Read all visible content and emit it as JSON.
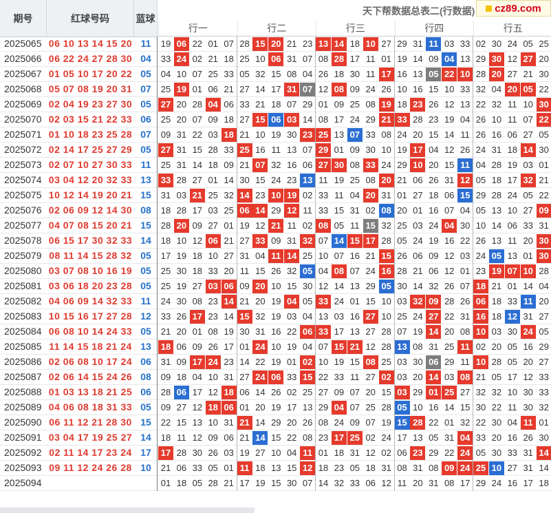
{
  "header": {
    "col_period": "期号",
    "col_red": "红球号码",
    "col_blue": "蓝球",
    "title": "天下帮数据总表二(行数据)",
    "logo": "cz89.com",
    "groups": [
      "行一",
      "行二",
      "行三",
      "行四",
      "行五"
    ]
  },
  "colors": {
    "red": "#e53a2c",
    "blue": "#2b6ed3",
    "gray": "#7d7d7d",
    "red_text": "#e03a2f",
    "blue_text": "#2570c8"
  },
  "rows": [
    {
      "period": "2025065",
      "reds": "06 10 13 14 15 20",
      "blue": "11",
      "cells": "19 *06 22 01 07|28 *15 *20 21 23|*13 *14 18 *10 27|29 31 +11 03 33|02 30 24 05 25"
    },
    {
      "period": "2025066",
      "reds": "06 22 24 27 28 30",
      "blue": "04",
      "cells": "33 *24 02 21 18|25 10 *06 31 07|08 *28 17 11 01|19 14 09 +04 13|29 *30 12 *27 20"
    },
    {
      "period": "2025067",
      "reds": "01 05 10 17 20 22",
      "blue": "05",
      "cells": "04 10 07 25 33|05 32 15 08 04|26 18 30 11 *17|16 13 #05 *22 *10|28 *20 27 21 30"
    },
    {
      "period": "2025068",
      "reds": "05 07 08 19 20 31",
      "blue": "07",
      "cells": "25 *19 01 06 21|27 14 17 *31 #07|12 *08 09 24 26|10 16 15 10 33|32 04 *20 *05 22"
    },
    {
      "period": "2025069",
      "reds": "02 04 19 23 27 30",
      "blue": "05",
      "cells": "*27 20 28 *04 06|33 21 18 07 29|01 09 25 08 *19|18 *23 26 12 13|22 32 11 10 *30"
    },
    {
      "period": "2025070",
      "reds": "02 03 15 21 22 33",
      "blue": "06",
      "cells": "25 20 07 09 18|27 *15 +06 *03 14|08 17 24 29 *21|*33 28 23 19 04|26 10 11 07 *22"
    },
    {
      "period": "2025071",
      "reds": "01 10 18 23 25 28",
      "blue": "07",
      "cells": "09 31 22 03 *18|21 10 19 30 *23|*25 13 +07 33 08|24 20 15 14 11|26 16 06 27 05"
    },
    {
      "period": "2025072",
      "reds": "02 14 17 25 27 29",
      "blue": "05",
      "cells": "*27 31 15 28 33|*25 16 11 13 07|*29 01 09 30 10|19 *17 04 12 26|24 31 18 *14 30"
    },
    {
      "period": "2025073",
      "reds": "02 07 10 27 30 33",
      "blue": "11",
      "cells": "25 31 14 18 09|21 *07 32 16 06|*27 *30 08 *33 24|29 *10 20 15 +11|04 28 19 03 01"
    },
    {
      "period": "2025074",
      "reds": "03 04 12 20 32 33",
      "blue": "13",
      "cells": "*33 28 27 01 14|30 15 24 23 +13|11 19 25 08 *20|21 06 26 31 *12|05 18 17 *32 21"
    },
    {
      "period": "2025075",
      "reds": "10 12 14 19 20 21",
      "blue": "15",
      "cells": "31 03 *21 25 32|*14 23 *10 *19 02|33 11 04 *20 31|01 27 18 06 +15|29 28 24 05 22"
    },
    {
      "period": "2025076",
      "reds": "02 06 09 12 14 30",
      "blue": "08",
      "cells": "18 28 17 03 25|*06 *14 29 *12 11|33 15 31 02 +08|20 01 16 07 04|05 13 10 27 *09"
    },
    {
      "period": "2025077",
      "reds": "04 07 08 15 20 21",
      "blue": "15",
      "cells": "28 *20 09 27 01|19 12 *21 11 02|*08 05 11 #15 32|25 03 24 *04 30|10 14 06 33 31"
    },
    {
      "period": "2025078",
      "reds": "06 15 17 30 32 33",
      "blue": "14",
      "cells": "18 10 12 *06 21|27 *33 09 31 *32|07 +14 *15 *17 28|05 24 19 16 22|26 13 11 20 *30"
    },
    {
      "period": "2025079",
      "reds": "08 11 14 15 28 32",
      "blue": "05",
      "cells": "17 19 18 10 27|31 04 *11 *14 25|10 07 16 21 *15|26 06 09 12 03|24 +05 13 01 *30"
    },
    {
      "period": "2025080",
      "reds": "03 07 08 10 16 19",
      "blue": "05",
      "cells": "25 30 18 33 20|11 15 26 32 +05|04 *08 07 24 *16|28 21 06 12 01|23 *19 *07 *10 28"
    },
    {
      "period": "2025081",
      "reds": "03 06 18 20 23 28",
      "blue": "05",
      "cells": "25 19 27 *03 *06|09 *20 10 15 30|12 14 13 29 +05|30 14 32 26 07|*18 21 01 14 04"
    },
    {
      "period": "2025082",
      "reds": "04 06 09 14 32 33",
      "blue": "11",
      "cells": "24 30 08 23 *14|21 20 19 *04 05|*33 24 01 15 10|03 *32 *09 28 26|*06 18 33 +11 20"
    },
    {
      "period": "2025083",
      "reds": "10 15 16 17 27 28",
      "blue": "12",
      "cells": "33 26 *17 23 14|*15 32 19 03 04|13 03 16 *27 10|25 24 *27 22 31|*16 18 +12 31 27"
    },
    {
      "period": "2025084",
      "reds": "06 08 10 14 24 33",
      "blue": "05",
      "cells": "21 20 01 08 19|30 31 16 22 *06|*33 17 13 27 28|07 19 *14 20 08|*10 03 30 *24 05"
    },
    {
      "period": "2025085",
      "reds": "11 14 15 18 21 24",
      "blue": "13",
      "cells": "*18 06 09 26 17|01 *24 10 19 04|07 *15 *21 12 28|+13 08 31 25 *11|02 20 05 16 29"
    },
    {
      "period": "2025086",
      "reds": "02 06 08 10 17 24",
      "blue": "06",
      "cells": "31 09 *17 *24 23|14 22 19 01 *02|10 19 15 *08 25|03 30 #06 29 11|*10 28 05 20 27"
    },
    {
      "period": "2025087",
      "reds": "02 06 14 15 24 26",
      "blue": "08",
      "cells": "09 18 04 10 31|27 *24 *06 33 *15|22 33 11 27 *02|03 20 *14 03 *08|21 05 17 12 33"
    },
    {
      "period": "2025088",
      "reds": "01 03 13 18 21 25",
      "blue": "06",
      "cells": "28 +06 17 12 *18|06 14 26 02 25|27 09 07 20 15|*03 29 *01 *25 27|32 32 10 30 33"
    },
    {
      "period": "2025089",
      "reds": "04 06 08 18 31 33",
      "blue": "05",
      "cells": "09 27 12 *18 *06|01 20 19 17 13|29 *04 07 25 28|+05 10 16 14 15|30 22 11 30 32"
    },
    {
      "period": "2025090",
      "reds": "06 11 12 21 28 30",
      "blue": "15",
      "cells": "22 15 13 10 31|*21 14 29 20 26|08 24 09 07 19|+15 *28 22 01 32|22 30 04 *11 01"
    },
    {
      "period": "2025091",
      "reds": "03 04 17 19 25 27",
      "blue": "14",
      "cells": "18 11 12 09 06|21 +14 15 22 08|23 *17 *25 02 24|17 13 05 31 *04|33 20 16 26 30"
    },
    {
      "period": "2025092",
      "reds": "02 11 14 17 23 24",
      "blue": "17",
      "cells": "*17 28 30 26 03|19 27 10 04 *11|01 18 31 12 02|06 *23 29 22 *24|05 30 33 31 *14"
    },
    {
      "period": "2025093",
      "reds": "09 11 12 24 26 28",
      "blue": "10",
      "cells": "21 06 33 05 01|*11 18 13 15 *12|18 23 05 18 31|08 31 08 *09 *24|*25 +10 27 31 14"
    },
    {
      "period": "2025094",
      "reds": "",
      "blue": "",
      "cells": "01 18 05 28 21|17 19 15 30 07|14 32 33 06 12|11 20 31 08 17|29 24 16 17 18"
    }
  ]
}
